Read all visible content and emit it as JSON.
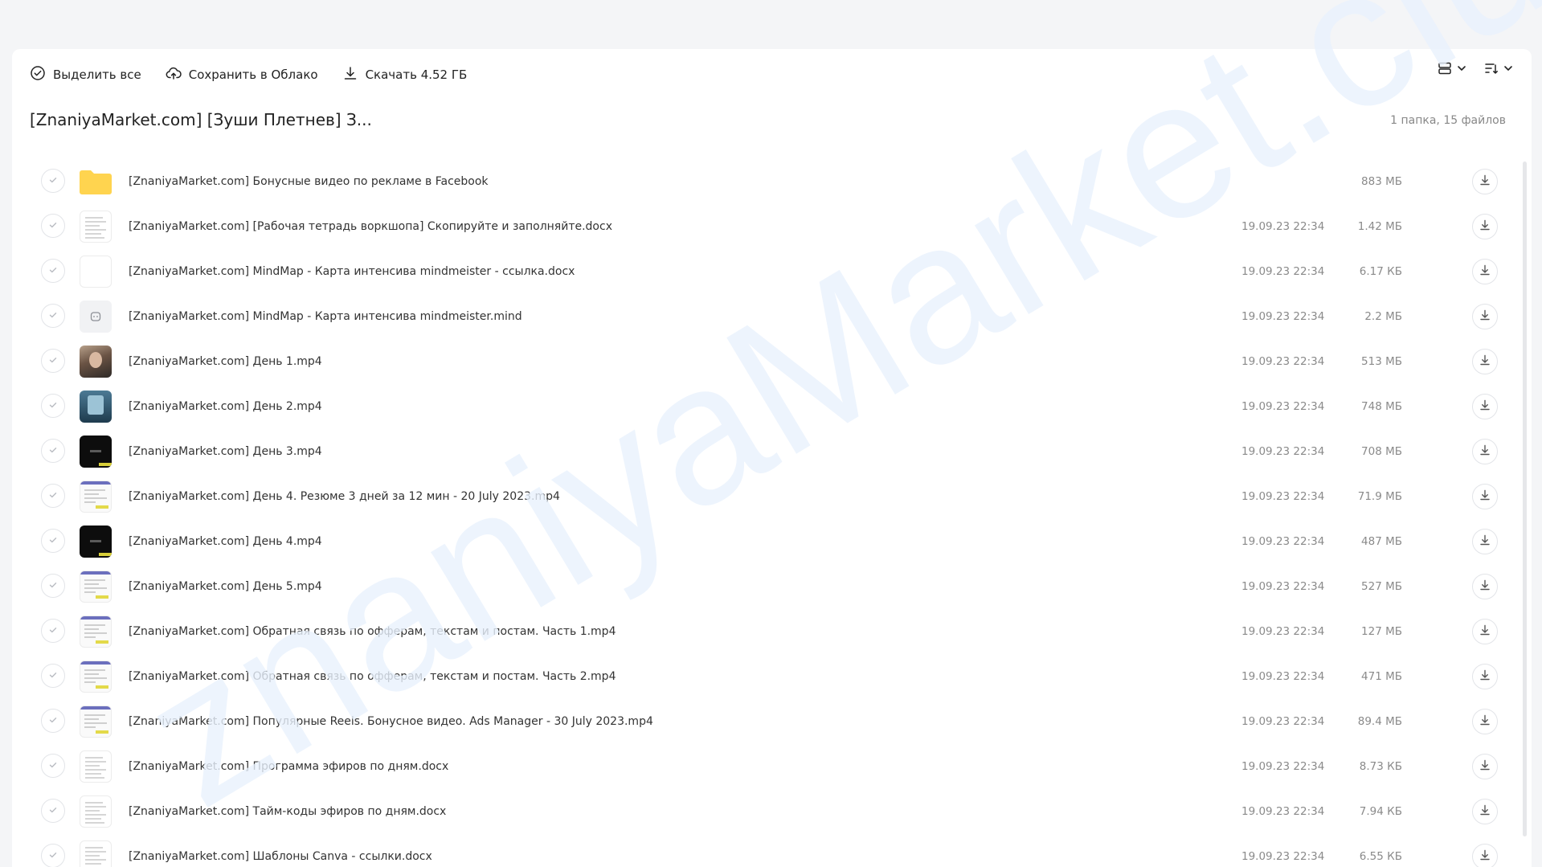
{
  "toolbar": {
    "select_all_label": "Выделить все",
    "save_cloud_label": "Сохранить в Облако",
    "download_label": "Скачать 4.52 ГБ"
  },
  "folder": {
    "title": "[ZnaniyaMarket.com] [Зуши Плетнев] З...",
    "meta": "1 папка, 15 файлов"
  },
  "files": [
    {
      "name": "[ZnaniyaMarket.com] Бонусные видео по рекламе в Facebook",
      "date": "",
      "size": "883 МБ",
      "thumb": "folder"
    },
    {
      "name": "[ZnaniyaMarket.com] [Рабочая тетрадь воркшопа] Скопируйте и заполняйте.docx",
      "date": "19.09.23 22:34",
      "size": "1.42 МБ",
      "thumb": "doc"
    },
    {
      "name": "[ZnaniyaMarket.com] MindMap - Карта интенсива mindmeister - ссылка.docx",
      "date": "19.09.23 22:34",
      "size": "6.17 КБ",
      "thumb": "blank"
    },
    {
      "name": "[ZnaniyaMarket.com] MindMap - Карта интенсива mindmeister.mind",
      "date": "19.09.23 22:34",
      "size": "2.2 МБ",
      "thumb": "mind"
    },
    {
      "name": "[ZnaniyaMarket.com] День 1.mp4",
      "date": "19.09.23 22:34",
      "size": "513 МБ",
      "thumb": "face"
    },
    {
      "name": "[ZnaniyaMarket.com] День 2.mp4",
      "date": "19.09.23 22:34",
      "size": "748 МБ",
      "thumb": "call"
    },
    {
      "name": "[ZnaniyaMarket.com] День 3.mp4",
      "date": "19.09.23 22:34",
      "size": "708 МБ",
      "thumb": "black"
    },
    {
      "name": "[ZnaniyaMarket.com] День 4. Резюме 3 дней за 12 мин - 20 July 2023.mp4",
      "date": "19.09.23 22:34",
      "size": "71.9 МБ",
      "thumb": "screen"
    },
    {
      "name": "[ZnaniyaMarket.com] День 4.mp4",
      "date": "19.09.23 22:34",
      "size": "487 МБ",
      "thumb": "black"
    },
    {
      "name": "[ZnaniyaMarket.com] День 5.mp4",
      "date": "19.09.23 22:34",
      "size": "527 МБ",
      "thumb": "screen"
    },
    {
      "name": "[ZnaniyaMarket.com] Обратная связь по офферам, текстам и постам. Часть 1.mp4",
      "date": "19.09.23 22:34",
      "size": "127 МБ",
      "thumb": "screen"
    },
    {
      "name": "[ZnaniyaMarket.com] Обратная связь по офферам, текстам и постам. Часть 2.mp4",
      "date": "19.09.23 22:34",
      "size": "471 МБ",
      "thumb": "screen"
    },
    {
      "name": "[ZnaniyaMarket.com] Популярные Reels. Бонусное видео. Ads Manager - 30 July 2023.mp4",
      "date": "19.09.23 22:34",
      "size": "89.4 МБ",
      "thumb": "screen"
    },
    {
      "name": "[ZnaniyaMarket.com] Программа эфиров по дням.docx",
      "date": "19.09.23 22:34",
      "size": "8.73 КБ",
      "thumb": "doc"
    },
    {
      "name": "[ZnaniyaMarket.com] Тайм-коды эфиров по дням.docx",
      "date": "19.09.23 22:34",
      "size": "7.94 КБ",
      "thumb": "doc"
    },
    {
      "name": "[ZnaniyaMarket.com] Шаблоны Canva - ссылки.docx",
      "date": "19.09.23 22:34",
      "size": "6.55 КБ",
      "thumb": "doc"
    }
  ],
  "watermark": "znaniyaMarket.club",
  "colors": {
    "page_bg": "#f4f5f7",
    "panel_bg": "#ffffff",
    "folder_yellow": "#ffd44f",
    "watermark": "#e8f1fd"
  }
}
